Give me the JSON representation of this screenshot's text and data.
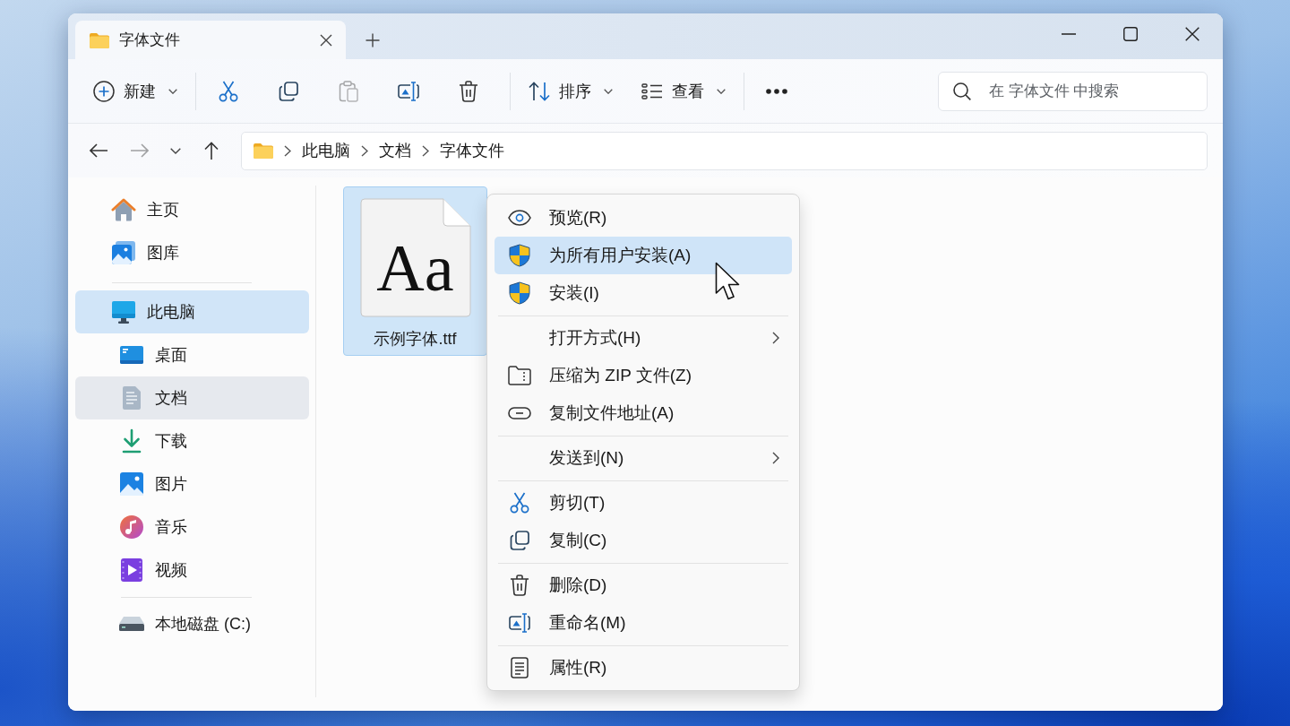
{
  "window": {
    "tabs": [
      {
        "title": "字体文件",
        "selected": true
      }
    ]
  },
  "toolbar": {
    "groups": [
      {
        "items": [
          {
            "label": "新建",
            "dropdown": true,
            "disabled": false
          }
        ]
      },
      {
        "items": [
          {
            "disabled": false
          },
          {
            "disabled": false
          },
          {
            "disabled": true
          },
          {
            "disabled": false
          },
          {
            "disabled": false
          }
        ]
      },
      {
        "items": [
          {
            "label": "排序",
            "dropdown": true,
            "disabled": false
          },
          {
            "label": "查看",
            "dropdown": true,
            "disabled": false
          }
        ]
      },
      {
        "items": [
          {
            "disabled": false
          }
        ]
      }
    ]
  },
  "search": {
    "placeholder": "在 字体文件 中搜索"
  },
  "navigation": {
    "buttons": [
      {
        "disabled": false
      },
      {
        "disabled": true
      },
      {
        "disabled": false
      },
      {
        "disabled": false
      }
    ]
  },
  "address_bar": {
    "path": [
      "此电脑",
      "文档",
      "字体文件"
    ]
  },
  "sidebar": {
    "groups": [
      {
        "items": [
          {
            "label": "主页",
            "selected": false,
            "hovered": false
          },
          {
            "label": "图库",
            "selected": false,
            "hovered": false
          }
        ]
      },
      {
        "items": [
          {
            "label": "此电脑",
            "selected": true,
            "hovered": false,
            "children": [
              {
                "label": "桌面",
                "kind": "folder",
                "selected": false,
                "hovered": false
              },
              {
                "label": "文档",
                "kind": "folder",
                "selected": false,
                "hovered": true
              },
              {
                "label": "下载",
                "kind": "folder",
                "selected": false,
                "hovered": false
              },
              {
                "label": "图片",
                "kind": "folder",
                "selected": false,
                "hovered": false
              },
              {
                "label": "音乐",
                "kind": "folder",
                "selected": false,
                "hovered": false
              },
              {
                "label": "视频",
                "kind": "folder",
                "selected": false,
                "hovered": false
              },
              {
                "label": "本地磁盘 (C:)",
                "kind": "drive",
                "selected": false,
                "hovered": false
              }
            ]
          }
        ]
      }
    ]
  },
  "files": [
    {
      "name": "示例字体.ttf",
      "preview": "Aa",
      "selected": true
    }
  ],
  "context_menu": {
    "groups": [
      {
        "items": [
          {
            "label": "预览(R)",
            "hovered": false,
            "submenu": false
          },
          {
            "label": "为所有用户安装(A)",
            "hovered": true,
            "submenu": false
          },
          {
            "label": "安装(I)",
            "hovered": false,
            "submenu": false
          }
        ]
      },
      {
        "items": [
          {
            "label": "打开方式(H)",
            "hovered": false,
            "submenu": true
          },
          {
            "label": "压缩为 ZIP 文件(Z)",
            "hovered": false,
            "submenu": false
          },
          {
            "label": "复制文件地址(A)",
            "hovered": false,
            "submenu": false
          }
        ]
      },
      {
        "items": [
          {
            "label": "发送到(N)",
            "hovered": false,
            "submenu": true
          }
        ]
      },
      {
        "items": [
          {
            "label": "剪切(T)",
            "hovered": false,
            "submenu": false
          },
          {
            "label": "复制(C)",
            "hovered": false,
            "submenu": false
          }
        ]
      },
      {
        "items": [
          {
            "label": "删除(D)",
            "hovered": false,
            "submenu": false
          },
          {
            "label": "重命名(M)",
            "hovered": false,
            "submenu": false
          }
        ]
      },
      {
        "items": [
          {
            "label": "属性(R)",
            "hovered": false,
            "submenu": false
          }
        ]
      }
    ]
  }
}
